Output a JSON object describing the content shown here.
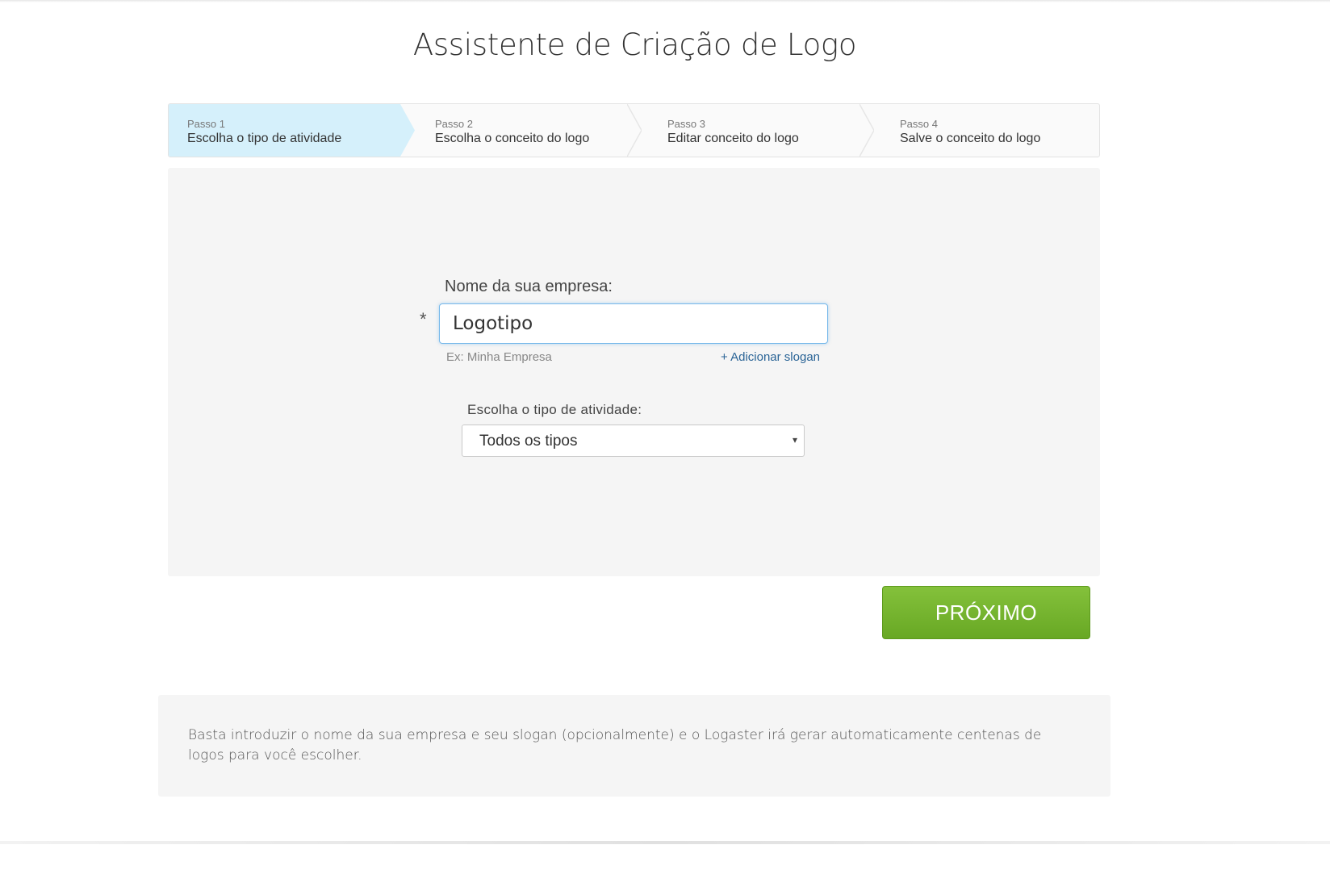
{
  "header": {
    "title": "Assistente de Criação de Logo"
  },
  "steps": [
    {
      "num": "Passo 1",
      "label": "Escolha o tipo de atividade",
      "active": true
    },
    {
      "num": "Passo 2",
      "label": "Escolha o conceito do logo",
      "active": false
    },
    {
      "num": "Passo 3",
      "label": "Editar conceito do logo",
      "active": false
    },
    {
      "num": "Passo 4",
      "label": "Salve o conceito do logo",
      "active": false
    }
  ],
  "form": {
    "company_label": "Nome da sua empresa:",
    "required_marker": "*",
    "company_value": "Logotipo",
    "example_hint": "Ex: Minha Empresa",
    "add_slogan": "+ Adicionar slogan",
    "type_label": "Escolha o tipo de atividade:",
    "type_selected": "Todos os tipos",
    "chevron": "▾"
  },
  "actions": {
    "next_label": "PRÓXIMO"
  },
  "info": {
    "text": "Basta introduzir o nome da sua empresa e seu slogan (opcionalmente) e o Logaster irá gerar automaticamente centenas de logos para você escolher."
  },
  "colors": {
    "active_step": "#d5f0fb",
    "button_green": "#76b52f",
    "link_blue": "#2a6496",
    "panel_bg": "#f5f5f5"
  }
}
